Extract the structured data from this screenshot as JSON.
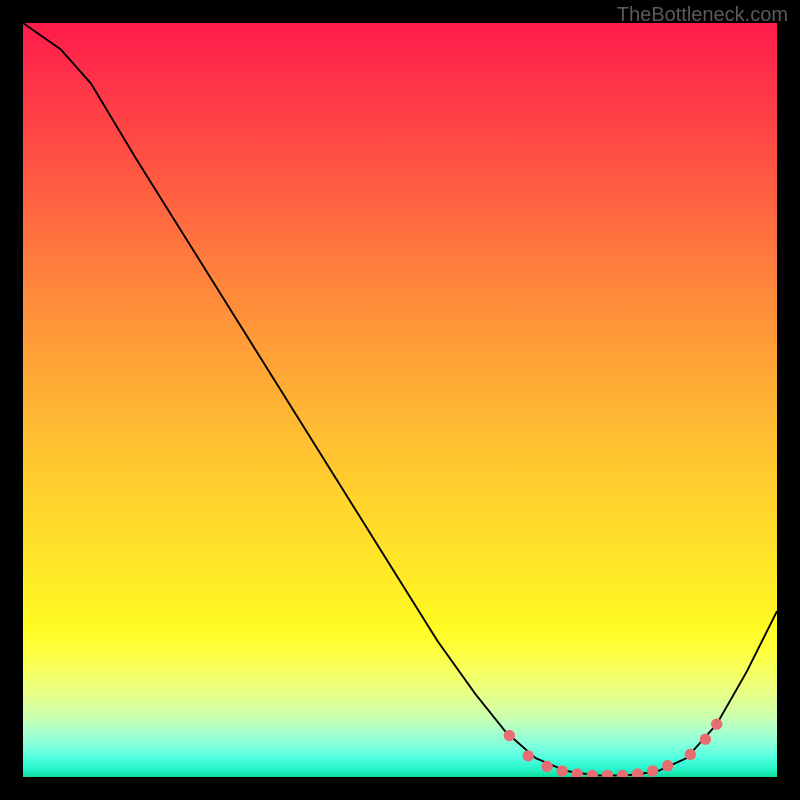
{
  "watermark": "TheBottleneck.com",
  "colors": {
    "curve_stroke": "#000000",
    "point_fill": "#e86d72",
    "point_stroke": "#e86d72"
  },
  "chart_data": {
    "type": "line",
    "title": "",
    "xlabel": "",
    "ylabel": "",
    "x_range": [
      0,
      100
    ],
    "y_range": [
      0,
      100
    ],
    "note": "x/y are relative percentages within the plot area (0=left/top, 100=right/bottom). No axis ticks visible in source.",
    "curve": [
      {
        "x": 0.0,
        "y": 0.0
      },
      {
        "x": 5.0,
        "y": 3.5
      },
      {
        "x": 9.0,
        "y": 8.0
      },
      {
        "x": 15.0,
        "y": 18.0
      },
      {
        "x": 25.0,
        "y": 34.0
      },
      {
        "x": 35.0,
        "y": 50.0
      },
      {
        "x": 45.0,
        "y": 66.0
      },
      {
        "x": 55.0,
        "y": 82.0
      },
      {
        "x": 60.0,
        "y": 89.0
      },
      {
        "x": 64.0,
        "y": 94.0
      },
      {
        "x": 68.0,
        "y": 97.5
      },
      {
        "x": 72.0,
        "y": 99.2
      },
      {
        "x": 76.0,
        "y": 99.8
      },
      {
        "x": 80.0,
        "y": 99.8
      },
      {
        "x": 84.0,
        "y": 99.3
      },
      {
        "x": 88.0,
        "y": 97.5
      },
      {
        "x": 92.0,
        "y": 93.0
      },
      {
        "x": 96.0,
        "y": 86.0
      },
      {
        "x": 100.0,
        "y": 78.0
      }
    ],
    "points": [
      {
        "x": 64.5,
        "y": 94.5
      },
      {
        "x": 67.0,
        "y": 97.2
      },
      {
        "x": 69.5,
        "y": 98.6
      },
      {
        "x": 71.5,
        "y": 99.2
      },
      {
        "x": 73.5,
        "y": 99.6
      },
      {
        "x": 75.5,
        "y": 99.8
      },
      {
        "x": 77.5,
        "y": 99.8
      },
      {
        "x": 79.5,
        "y": 99.8
      },
      {
        "x": 81.5,
        "y": 99.6
      },
      {
        "x": 83.5,
        "y": 99.2
      },
      {
        "x": 85.5,
        "y": 98.5
      },
      {
        "x": 88.5,
        "y": 97.0
      },
      {
        "x": 90.5,
        "y": 95.0
      },
      {
        "x": 92.0,
        "y": 93.0
      }
    ]
  }
}
